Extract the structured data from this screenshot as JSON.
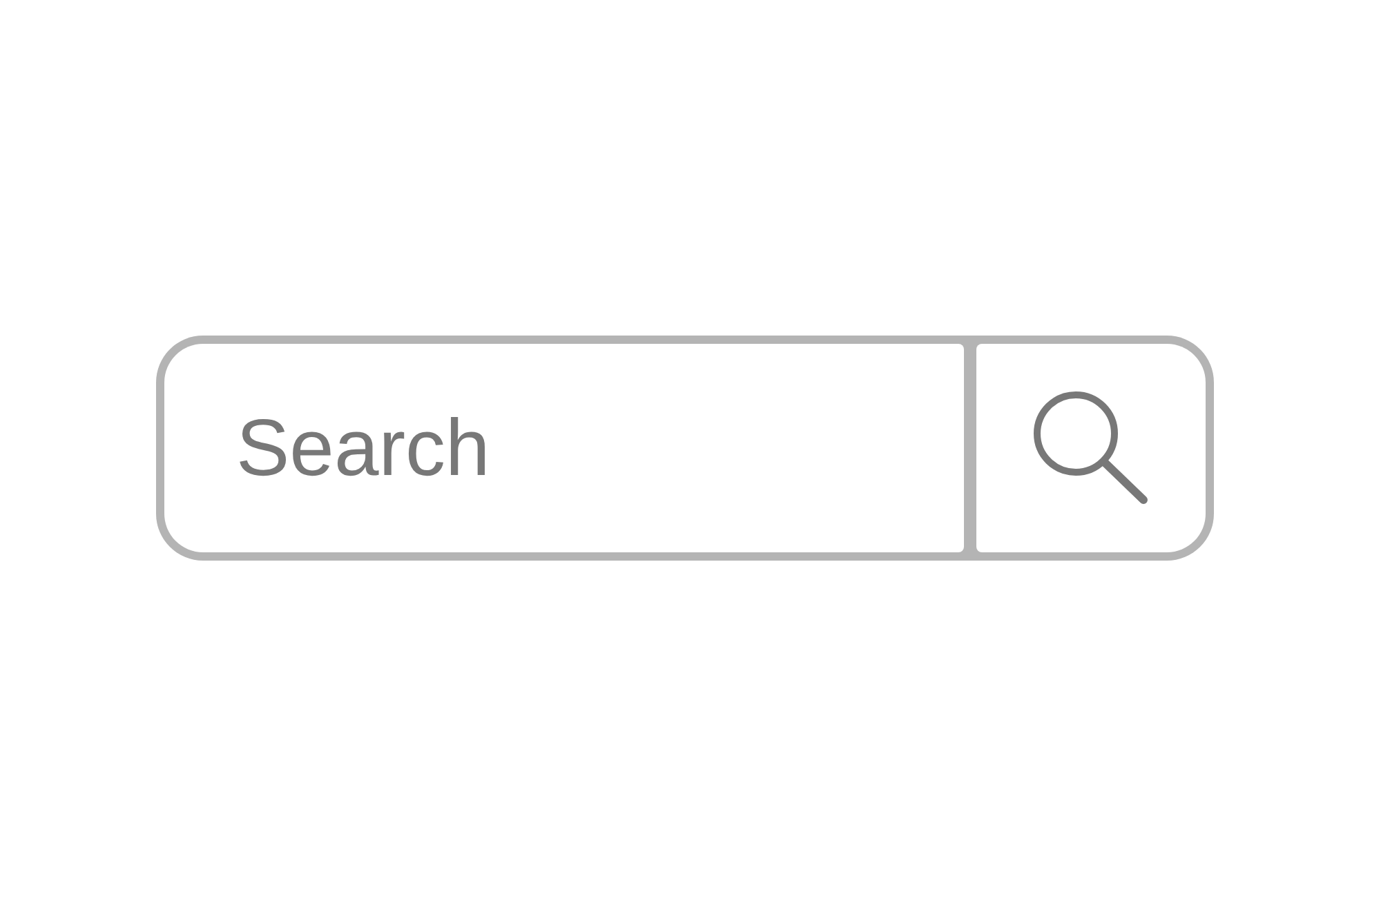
{
  "search": {
    "placeholder": "Search"
  }
}
